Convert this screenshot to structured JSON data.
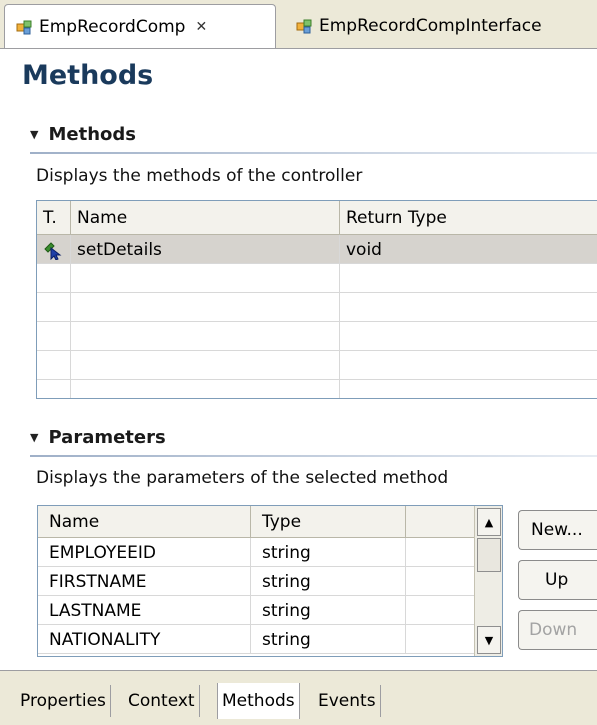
{
  "editor_tabs": [
    {
      "label": "EmpRecordComp",
      "icon": "component-icon",
      "active": true,
      "close": "✕"
    },
    {
      "label": "EmpRecordCompInterface",
      "icon": "component-icon",
      "active": false
    }
  ],
  "page_title": "Methods",
  "methods_section": {
    "title": "Methods",
    "description": "Displays the methods of the controller",
    "columns": [
      "T.",
      "Name",
      "Return Type"
    ],
    "rows": [
      {
        "icon": "method-icon",
        "name": "setDetails",
        "return_type": "void"
      }
    ]
  },
  "parameters_section": {
    "title": "Parameters",
    "description": "Displays the parameters of the selected method",
    "columns": [
      "Name",
      "Type"
    ],
    "rows": [
      {
        "name": "EMPLOYEEID",
        "type": "string"
      },
      {
        "name": "FIRSTNAME",
        "type": "string"
      },
      {
        "name": "LASTNAME",
        "type": "string"
      },
      {
        "name": "NATIONALITY",
        "type": "string"
      }
    ],
    "buttons": {
      "new": "New...",
      "up": "Up",
      "down": "Down"
    }
  },
  "bottom_tabs": [
    {
      "label": "Properties",
      "active": false
    },
    {
      "label": "Context",
      "active": false
    },
    {
      "label": "Methods",
      "active": true
    },
    {
      "label": "Events",
      "active": false
    }
  ],
  "colors": {
    "title": "#1a3a5c",
    "selected_row": "#d6d3ce",
    "chrome": "#ece9d8"
  }
}
